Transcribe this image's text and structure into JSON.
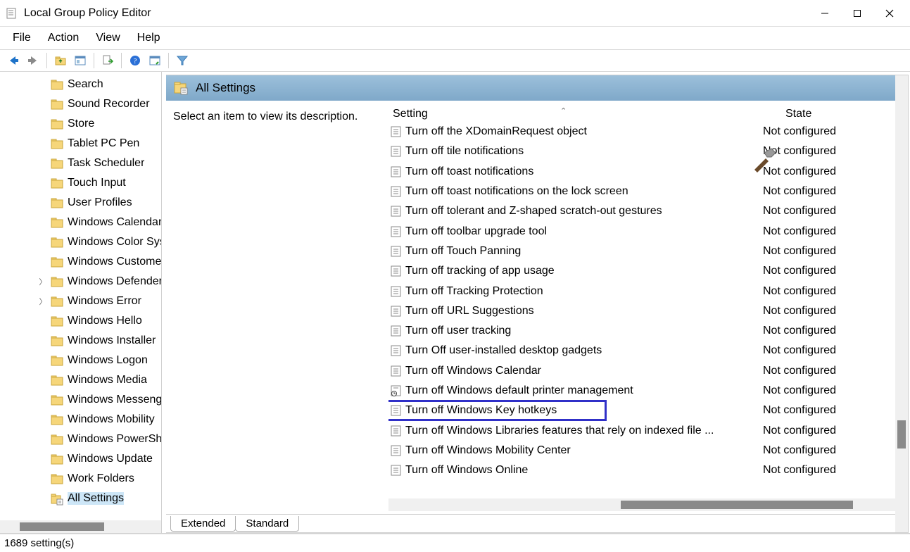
{
  "window": {
    "title": "Local Group Policy Editor"
  },
  "menu": {
    "file": "File",
    "action": "Action",
    "view": "View",
    "help": "Help"
  },
  "tree": {
    "items": [
      {
        "label": "Search",
        "expandable": false
      },
      {
        "label": "Sound Recorder",
        "expandable": false
      },
      {
        "label": "Store",
        "expandable": false
      },
      {
        "label": "Tablet PC Pen",
        "expandable": false
      },
      {
        "label": "Task Scheduler",
        "expandable": false
      },
      {
        "label": "Touch Input",
        "expandable": false
      },
      {
        "label": "User Profiles",
        "expandable": false
      },
      {
        "label": "Windows Calendar",
        "expandable": false
      },
      {
        "label": "Windows Color System",
        "expandable": false
      },
      {
        "label": "Windows Customer",
        "expandable": false
      },
      {
        "label": "Windows Defender",
        "expandable": true
      },
      {
        "label": "Windows Error",
        "expandable": true
      },
      {
        "label": "Windows Hello",
        "expandable": false
      },
      {
        "label": "Windows Installer",
        "expandable": false
      },
      {
        "label": "Windows Logon",
        "expandable": false
      },
      {
        "label": "Windows Media",
        "expandable": false
      },
      {
        "label": "Windows Messenger",
        "expandable": false
      },
      {
        "label": "Windows Mobility",
        "expandable": false
      },
      {
        "label": "Windows PowerShell",
        "expandable": false
      },
      {
        "label": "Windows Update",
        "expandable": false
      },
      {
        "label": "Work Folders",
        "expandable": false
      }
    ],
    "special_item": {
      "label": "All Settings",
      "selected": true
    }
  },
  "right": {
    "header": "All Settings",
    "description_placeholder": "Select an item to view its description.",
    "columns": {
      "setting": "Setting",
      "state": "State"
    },
    "settings": [
      {
        "name": "Turn off the XDomainRequest object",
        "state": "Not configured"
      },
      {
        "name": "Turn off tile notifications",
        "state": "Not configured"
      },
      {
        "name": "Turn off toast notifications",
        "state": "Not configured"
      },
      {
        "name": "Turn off toast notifications on the lock screen",
        "state": "Not configured"
      },
      {
        "name": "Turn off tolerant and Z-shaped scratch-out gestures",
        "state": "Not configured"
      },
      {
        "name": "Turn off toolbar upgrade tool",
        "state": "Not configured"
      },
      {
        "name": "Turn off Touch Panning",
        "state": "Not configured"
      },
      {
        "name": "Turn off tracking of app usage",
        "state": "Not configured"
      },
      {
        "name": "Turn off Tracking Protection",
        "state": "Not configured"
      },
      {
        "name": "Turn off URL Suggestions",
        "state": "Not configured"
      },
      {
        "name": "Turn off user tracking",
        "state": "Not configured"
      },
      {
        "name": "Turn Off user-installed desktop gadgets",
        "state": "Not configured"
      },
      {
        "name": "Turn off Windows Calendar",
        "state": "Not configured"
      },
      {
        "name": "Turn off Windows default printer management",
        "state": "Not configured",
        "icon": "printer"
      },
      {
        "name": "Turn off Windows Key hotkeys",
        "state": "Not configured",
        "highlighted": true
      },
      {
        "name": "Turn off Windows Libraries features that rely on indexed file ...",
        "state": "Not configured"
      },
      {
        "name": "Turn off Windows Mobility Center",
        "state": "Not configured"
      },
      {
        "name": "Turn off Windows Online",
        "state": "Not configured"
      }
    ]
  },
  "tabs": {
    "extended": "Extended",
    "standard": "Standard"
  },
  "status": {
    "count": "1689 setting(s)"
  }
}
